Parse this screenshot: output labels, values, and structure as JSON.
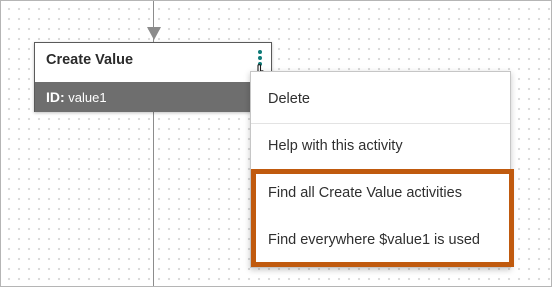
{
  "card": {
    "title": "Create Value",
    "id_label": "ID:",
    "id_value": "value1",
    "more_icon": "vertical-ellipsis"
  },
  "context_menu": {
    "items": [
      {
        "label": "Delete"
      },
      {
        "label": "Help with this activity"
      },
      {
        "label": "Find all Create Value activities"
      },
      {
        "label": "Find everywhere $value1 is used"
      }
    ]
  },
  "colors": {
    "accent": "#0f7a78",
    "highlight_border": "#c05a0e",
    "card_footer_bg": "#6e6e6e",
    "connector": "#8c8c8c"
  }
}
